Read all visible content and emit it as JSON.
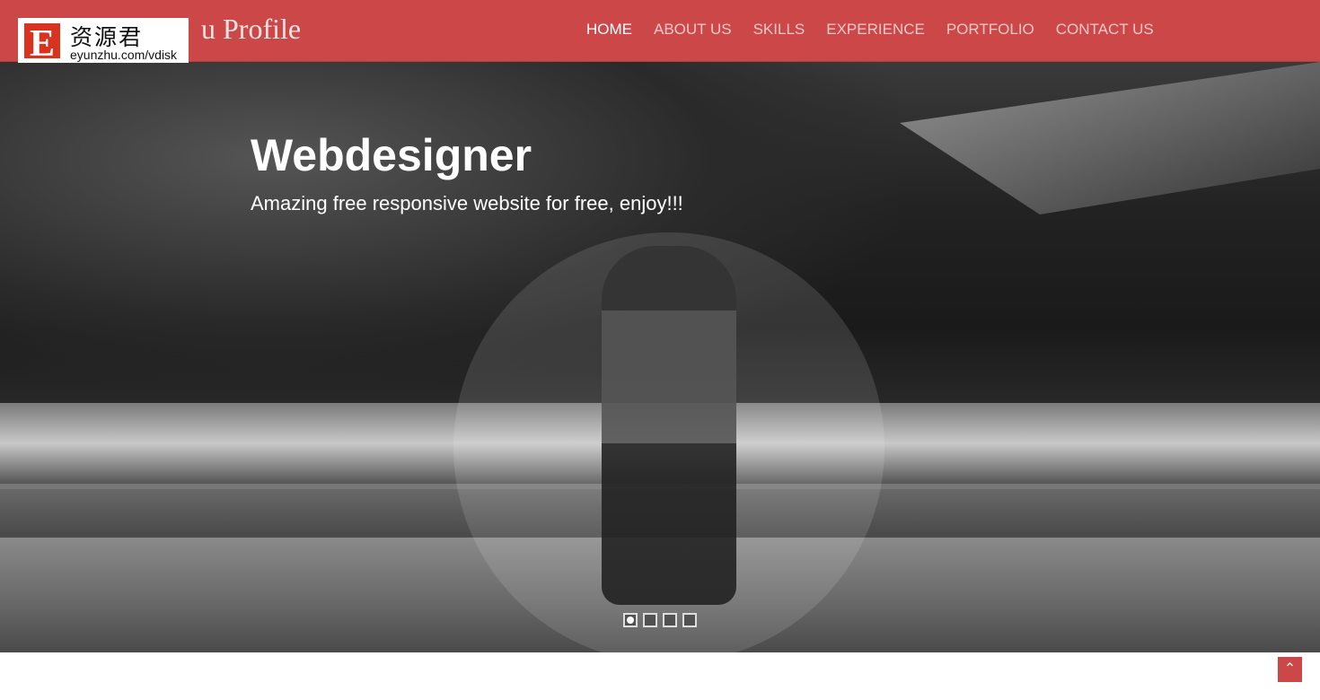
{
  "nav": {
    "brand": "u Profile",
    "items": [
      {
        "label": "HOME",
        "active": true
      },
      {
        "label": "ABOUT US"
      },
      {
        "label": "SKILLS"
      },
      {
        "label": "EXPERIENCE"
      },
      {
        "label": "PORTFOLIO"
      },
      {
        "label": "CONTACT US"
      }
    ]
  },
  "watermark": {
    "logo_letter": "E",
    "chinese": "资源君",
    "url": "eyunzhu.com/vdisk"
  },
  "hero": {
    "title": "Webdesigner",
    "subtitle": "Amazing free responsive website for free, enjoy!!!",
    "slides": 4,
    "active_slide": 1
  },
  "scroll_top": {
    "icon": "chevron-up-icon"
  },
  "colors": {
    "accent": "#cc4747"
  }
}
